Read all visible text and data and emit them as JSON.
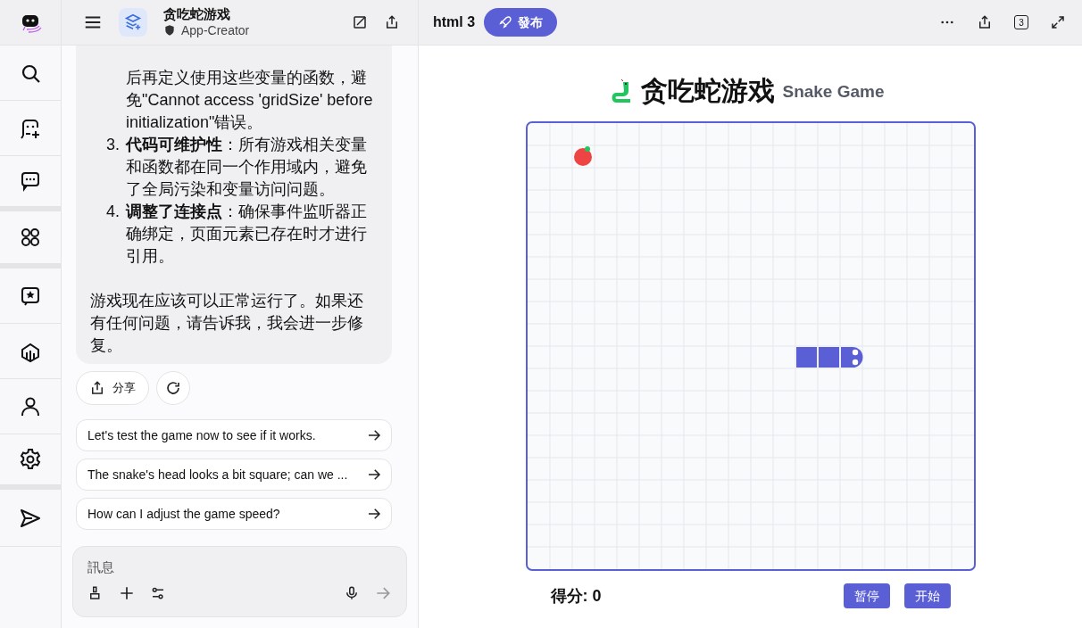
{
  "chat_header": {
    "title": "贪吃蛇游戏",
    "subtitle": "App-Creator"
  },
  "message": {
    "list_items": [
      {
        "text": "后再定义使用这些变量的函数，避免\"Cannot access 'gridSize' before initialization\"错误。"
      },
      {
        "number": "3.",
        "title": "代码可维护性",
        "text": "：所有游戏相关变量和函数都在同一个作用域内，避免了全局污染和变量访问问题。"
      },
      {
        "number": "4.",
        "title": "调整了连接点",
        "text": "：确保事件监听器正确绑定，页面元素已存在时才进行引用。"
      }
    ],
    "closing": "游戏现在应该可以正常运行了。如果还有任何问题，请告诉我，我会进一步修复。"
  },
  "share_button": "分享",
  "suggestions": [
    "Let's test the game now to see if it works.",
    "The snake's head looks a bit square; can we ...",
    "How can I adjust the game speed?"
  ],
  "composer": {
    "placeholder": "訊息"
  },
  "preview": {
    "title": "html 3",
    "publish_button": "發布",
    "version_badge": "3"
  },
  "game": {
    "title": "贪吃蛇游戏",
    "subtitle": "Snake Game",
    "score": "得分: 0",
    "buttons": [
      "暂停",
      "开始"
    ]
  }
}
